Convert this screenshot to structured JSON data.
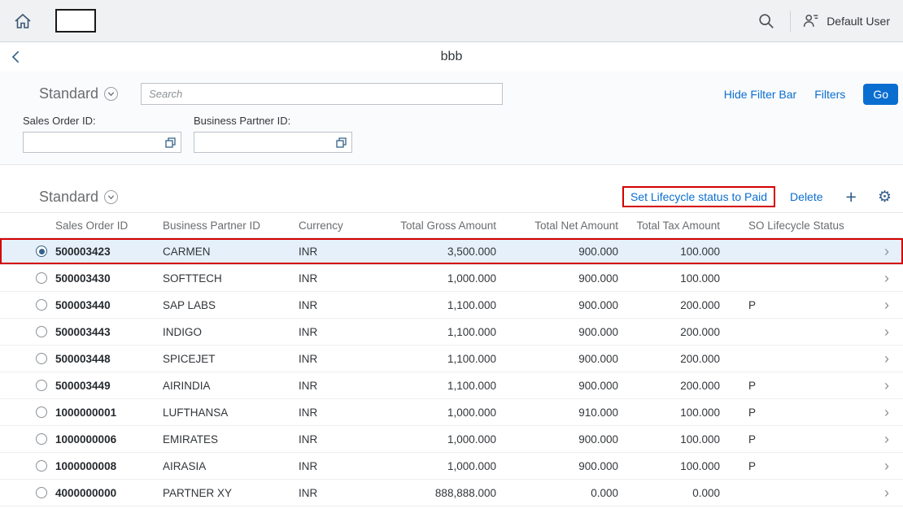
{
  "colors": {
    "accent_blue": "#0a6ed1",
    "link_blue": "#0a6ed1",
    "annotation_red": "#d40000",
    "shell_background": "#f0f1f3",
    "selected_row_background": "#e5f0fa"
  },
  "icons": {
    "home": "house-outline",
    "search": "magnifier",
    "user": "person-with-lines",
    "back": "chevron-left",
    "variant_dropdown": "chevron-down-in-circle",
    "value_help": "overlapping-squares",
    "add_glyph": "+",
    "settings_glyph": "⚙",
    "row_nav_glyph": "›"
  },
  "shell": {
    "user_label": "Default User"
  },
  "page": {
    "title": "bbb"
  },
  "filter_bar": {
    "variant": "Standard",
    "search_placeholder": "Search",
    "hide_filter_bar_label": "Hide Filter Bar",
    "filters_label": "Filters",
    "go_label": "Go",
    "fields": [
      {
        "label": "Sales Order ID:",
        "value": ""
      },
      {
        "label": "Business Partner ID:",
        "value": ""
      }
    ]
  },
  "table": {
    "variant": "Standard",
    "set_lifecycle_label": "Set Lifecycle status to Paid",
    "delete_label": "Delete",
    "columns": [
      "Sales Order ID",
      "Business Partner ID",
      "Currency",
      "Total Gross Amount",
      "Total Net Amount",
      "Total Tax Amount",
      "SO Lifecycle Status"
    ],
    "rows": [
      {
        "selected": true,
        "annotated": true,
        "sales_order_id": "500003423",
        "business_partner_id": "CARMEN",
        "currency": "INR",
        "total_gross_amount": "3,500.000",
        "total_net_amount": "900.000",
        "total_tax_amount": "100.000",
        "so_lifecycle_status": ""
      },
      {
        "selected": false,
        "sales_order_id": "500003430",
        "business_partner_id": "SOFTTECH",
        "currency": "INR",
        "total_gross_amount": "1,000.000",
        "total_net_amount": "900.000",
        "total_tax_amount": "100.000",
        "so_lifecycle_status": ""
      },
      {
        "selected": false,
        "sales_order_id": "500003440",
        "business_partner_id": "SAP LABS",
        "currency": "INR",
        "total_gross_amount": "1,100.000",
        "total_net_amount": "900.000",
        "total_tax_amount": "200.000",
        "so_lifecycle_status": "P"
      },
      {
        "selected": false,
        "sales_order_id": "500003443",
        "business_partner_id": "INDIGO",
        "currency": "INR",
        "total_gross_amount": "1,100.000",
        "total_net_amount": "900.000",
        "total_tax_amount": "200.000",
        "so_lifecycle_status": ""
      },
      {
        "selected": false,
        "sales_order_id": "500003448",
        "business_partner_id": "SPICEJET",
        "currency": "INR",
        "total_gross_amount": "1,100.000",
        "total_net_amount": "900.000",
        "total_tax_amount": "200.000",
        "so_lifecycle_status": ""
      },
      {
        "selected": false,
        "sales_order_id": "500003449",
        "business_partner_id": "AIRINDIA",
        "currency": "INR",
        "total_gross_amount": "1,100.000",
        "total_net_amount": "900.000",
        "total_tax_amount": "200.000",
        "so_lifecycle_status": "P"
      },
      {
        "selected": false,
        "sales_order_id": "1000000001",
        "business_partner_id": "LUFTHANSA",
        "currency": "INR",
        "total_gross_amount": "1,000.000",
        "total_net_amount": "910.000",
        "total_tax_amount": "100.000",
        "so_lifecycle_status": "P"
      },
      {
        "selected": false,
        "sales_order_id": "1000000006",
        "business_partner_id": "EMIRATES",
        "currency": "INR",
        "total_gross_amount": "1,000.000",
        "total_net_amount": "900.000",
        "total_tax_amount": "100.000",
        "so_lifecycle_status": "P"
      },
      {
        "selected": false,
        "sales_order_id": "1000000008",
        "business_partner_id": "AIRASIA",
        "currency": "INR",
        "total_gross_amount": "1,000.000",
        "total_net_amount": "900.000",
        "total_tax_amount": "100.000",
        "so_lifecycle_status": "P"
      },
      {
        "selected": false,
        "sales_order_id": "4000000000",
        "business_partner_id": "PARTNER XY",
        "currency": "INR",
        "total_gross_amount": "888,888.000",
        "total_net_amount": "0.000",
        "total_tax_amount": "0.000",
        "so_lifecycle_status": ""
      }
    ]
  }
}
